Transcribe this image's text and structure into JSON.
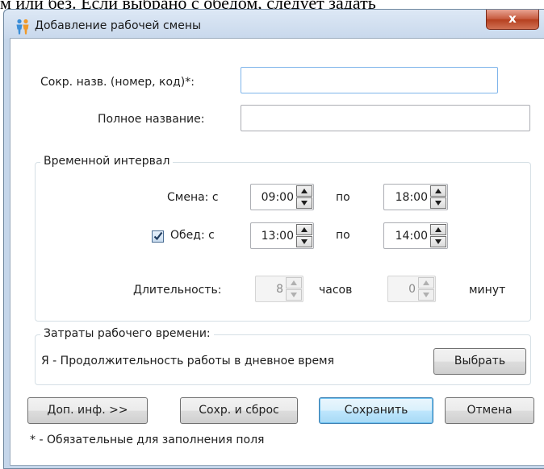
{
  "background": {
    "text": "м или без. Если выбрано с обедом, следует задать"
  },
  "window": {
    "title": "Добавление рабочей смены",
    "close_label": "x"
  },
  "form": {
    "short_name_label": "Сокр. назв. (номер, код)*:",
    "short_name_value": "",
    "full_name_label": "Полное название:",
    "full_name_value": ""
  },
  "interval": {
    "group_title": "Временной интервал",
    "shift_label": "Смена:  с",
    "shift_from": "09:00",
    "to_label": "по",
    "shift_to": "18:00",
    "lunch_checked": true,
    "lunch_label": "Обед: с",
    "lunch_from": "13:00",
    "lunch_to": "14:00",
    "duration_label": "Длительность:",
    "hours_value": "8",
    "hours_label": "часов",
    "minutes_value": "0",
    "minutes_label": "минут"
  },
  "cost": {
    "group_title": "Затраты рабочего времени:",
    "value": "Я - Продолжительность работы в дневное время",
    "select_button": "Выбрать"
  },
  "buttons": {
    "more_info": "Доп. инф. >>",
    "save_and_reset": "Сохр. и сброс",
    "save": "Сохранить",
    "cancel": "Отмена"
  },
  "footnote": "* - Обязательные для заполнения поля"
}
